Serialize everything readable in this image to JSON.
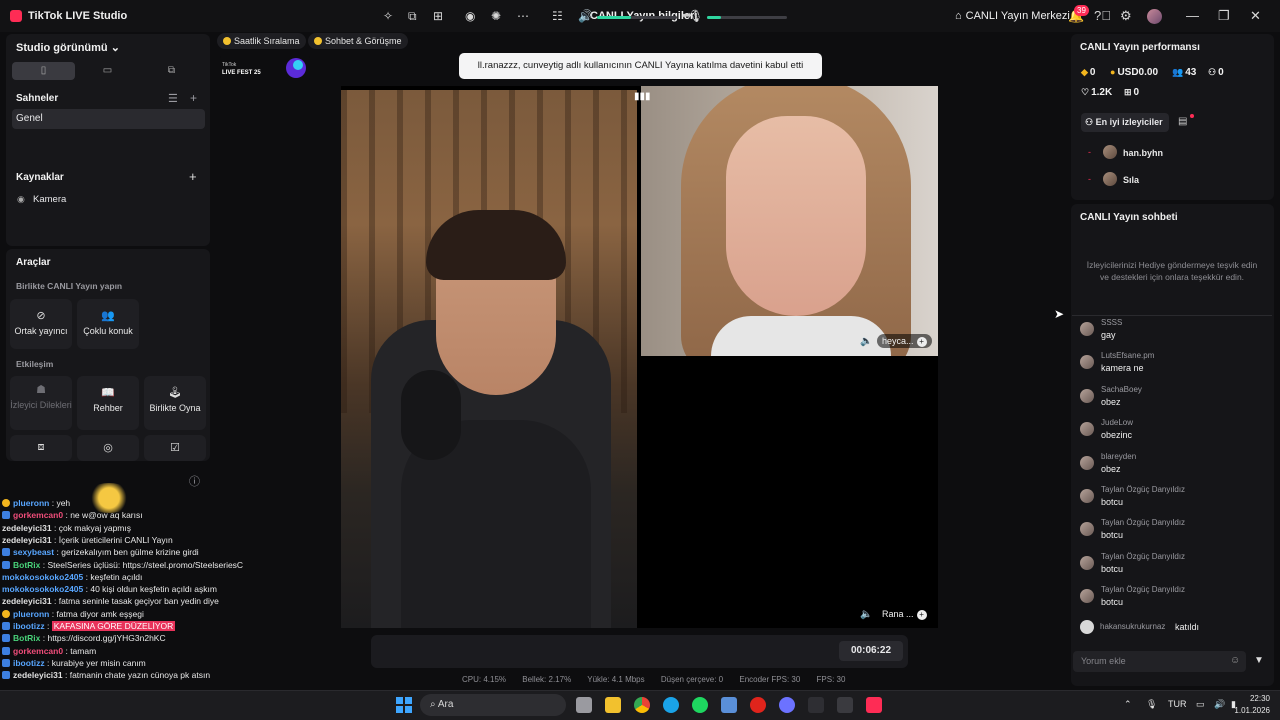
{
  "titlebar": {
    "app_name": "TikTok LIVE Studio",
    "center_title": "CANLI Yayın bilgileri",
    "live_center": "CANLI Yayın Merkezi",
    "notif_count": "39"
  },
  "left": {
    "studio_view": "Studio görünümü",
    "scenes_title": "Sahneler",
    "scene_item": "Genel",
    "sources_title": "Kaynaklar",
    "source_item": "Kamera",
    "tools_title": "Araçlar",
    "together_title": "Birlikte CANLI Yayın yapın",
    "tool_cohost": "Ortak yayıncı",
    "tool_multi_guest": "Çoklu konuk",
    "interaction_title": "Etkileşim",
    "tool_viewer_requests": "İzleyici Dilekleri",
    "tool_guide": "Rehber",
    "tool_play_together": "Birlikte Oyna"
  },
  "chat_overlay": {
    "lines": [
      {
        "user": "plueronn",
        "msg": "yeh",
        "ucolor": "blue",
        "badge": "y"
      },
      {
        "user": "gorkemcan0",
        "msg": "ne w@ow aq karısı",
        "ucolor": "pink",
        "badge": "b"
      },
      {
        "user": "zedeleyici31",
        "msg": "çok makyaj yapmış",
        "ucolor": "white",
        "badge": "none"
      },
      {
        "user": "zedeleyici31",
        "msg": "İçerik üreticilerini CANLI Yayın",
        "ucolor": "white",
        "badge": "none"
      },
      {
        "user": "sexybeast",
        "msg": "gerizekalıyım ben gülme krizine girdi",
        "ucolor": "blue",
        "badge": "b"
      },
      {
        "user": "BotRix",
        "msg": "SteelSeries üçlüsü: https://steel.promo/SteelseriesC",
        "ucolor": "green",
        "badge": "b"
      },
      {
        "user": "mokokosokoko2405",
        "msg": "keşfetin açıldı",
        "ucolor": "blue",
        "badge": "none"
      },
      {
        "user": "mokokosokoko2405",
        "msg": "40 kişi oldun keşfetin açıldı aşkım",
        "ucolor": "blue",
        "badge": "none"
      },
      {
        "user": "zedeleyici31",
        "msg": "fatma seninle tasak geçiyor ban yedin diye",
        "ucolor": "white",
        "badge": "none"
      },
      {
        "user": "plueronn",
        "msg": "fatma diyor amk eşşegi",
        "ucolor": "blue",
        "badge": "y"
      },
      {
        "user": "ibootizz",
        "msg": "KAFASINA GÖRE DÜZELİYOR",
        "ucolor": "blue",
        "badge": "b",
        "highlight": true
      },
      {
        "user": "BotRix",
        "msg": "https://discord.gg/jYHG3n2hKC",
        "ucolor": "green",
        "badge": "b"
      },
      {
        "user": "gorkemcan0",
        "msg": "tamam",
        "ucolor": "pink",
        "badge": "b"
      },
      {
        "user": "ibootizz",
        "msg": "kurabiye yer misin canım",
        "ucolor": "blue",
        "badge": "b"
      },
      {
        "user": "zedeleyici31",
        "msg": "fatmanin chate yazın cünoya pk atsın",
        "ucolor": "white",
        "badge": "b"
      }
    ]
  },
  "stage": {
    "chip_hourly": "Saatlik Sıralama",
    "chip_chat": "Sohbet & Görüşme",
    "fest_label": "TikTok LIVE FEST 25",
    "notice": "ll.ranazzz, cunveytig adlı kullanıcının CANLI Yayına katılma davetini kabul etti",
    "guest1_label": "heyca...",
    "guest2_label": "Rana ...",
    "timer": "00:06:22",
    "volume_level": 0.42,
    "mic_level": 0.18
  },
  "stats": {
    "cpu": "CPU: 4.15%",
    "memory": "Bellek: 2.17%",
    "upload": "Yükle: 4.1 Mbps",
    "dropped": "Düşen çerçeve: 0",
    "encoder_fps": "Encoder FPS: 30",
    "fps": "FPS: 30"
  },
  "right": {
    "perf_title": "CANLI Yayın performansı",
    "coins": "0",
    "usd": "USD0.00",
    "viewers": "43",
    "new_followers": "0",
    "likes": "1.2K",
    "gifts": "0",
    "top_viewers_label": "En iyi izleyiciler",
    "top_viewers": [
      "han.byhn",
      "Sıla"
    ],
    "chat_title": "CANLI Yayın sohbeti",
    "chat_hint": "İzleyicilerinizi Hediye göndermeye teşvik edin ve destekleri için onlara teşekkür edin.",
    "messages": [
      {
        "user": "SSSS",
        "msg": "gay"
      },
      {
        "user": "LutsEfsane.pm",
        "msg": "kamera ne"
      },
      {
        "user": "SachaBoey",
        "msg": "obez"
      },
      {
        "user": "JudeLow",
        "msg": "obezinc"
      },
      {
        "user": "blareyden",
        "msg": "obez"
      },
      {
        "user": "Taylan Özgüç Danyıldız",
        "msg": "botcu"
      },
      {
        "user": "Taylan Özgüç Danyıldız",
        "msg": "botcu"
      },
      {
        "user": "Taylan Özgüç Danyıldız",
        "msg": "botcu"
      },
      {
        "user": "Taylan Özgüç Danyıldız",
        "msg": "botcu"
      }
    ],
    "join_user": "hakansukrukurnaz",
    "join_text": "katıldı",
    "comment_placeholder": "Yorum ekle"
  },
  "taskbar": {
    "search": "Ara",
    "lang": "TUR",
    "time": "22:30",
    "date": "1.01.2026"
  }
}
